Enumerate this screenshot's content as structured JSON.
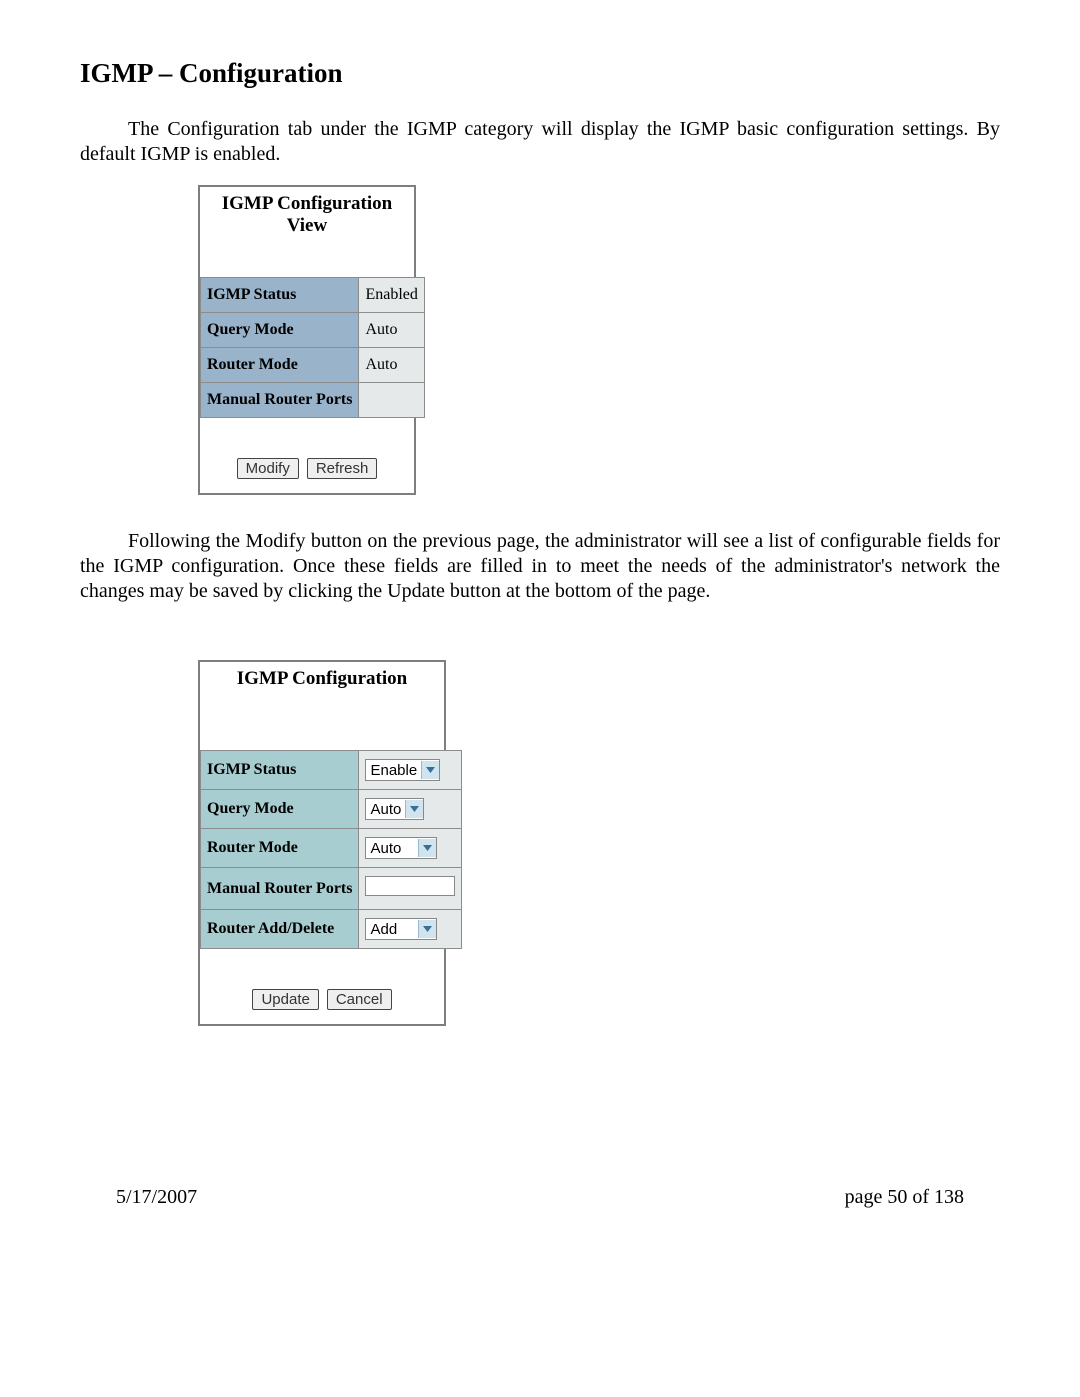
{
  "heading": "IGMP – Configuration",
  "para1": "The Configuration tab under the IGMP category will display the IGMP basic configuration settings.  By default IGMP is enabled.",
  "para2": "Following the Modify button on the previous page, the administrator will see a list of configurable fields for the IGMP configuration.  Once these fields are filled in to meet the needs of the administrator's network the changes may be saved by clicking the Update button at the bottom of the page.",
  "panel_view": {
    "title": "IGMP Configuration View",
    "rows": [
      {
        "label": "IGMP Status",
        "value": "Enabled"
      },
      {
        "label": "Query Mode",
        "value": "Auto"
      },
      {
        "label": "Router Mode",
        "value": "Auto"
      },
      {
        "label": "Manual Router Ports",
        "value": ""
      }
    ],
    "buttons": {
      "modify": "Modify",
      "refresh": "Refresh"
    }
  },
  "panel_edit": {
    "title": "IGMP Configuration",
    "rows": [
      {
        "label": "IGMP Status",
        "select": "Enable"
      },
      {
        "label": "Query Mode",
        "select": "Auto"
      },
      {
        "label": "Router Mode",
        "select": "Auto"
      },
      {
        "label": "Manual Router Ports",
        "input": ""
      },
      {
        "label": "Router Add/Delete",
        "select": "Add"
      }
    ],
    "buttons": {
      "update": "Update",
      "cancel": "Cancel"
    }
  },
  "footer": {
    "date": "5/17/2007",
    "page": "page 50 of 138"
  }
}
